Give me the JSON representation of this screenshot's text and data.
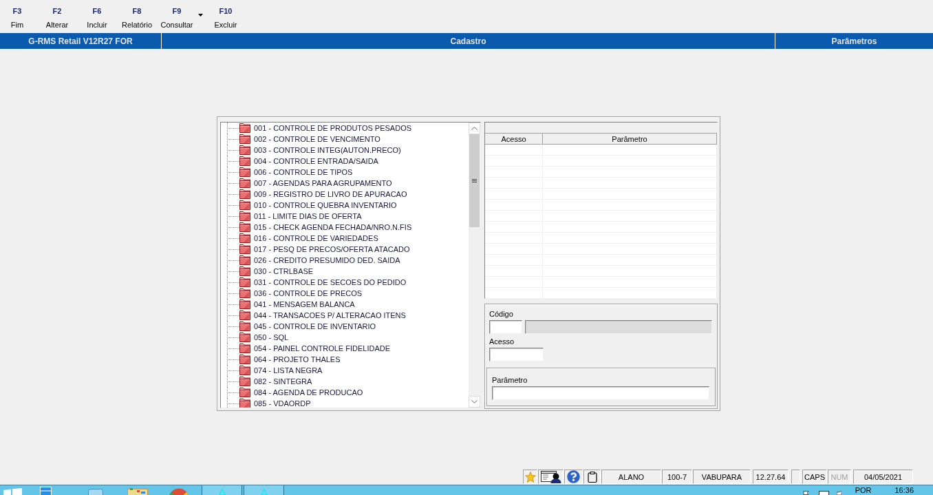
{
  "toolbar": {
    "buttons": [
      {
        "key": "F3",
        "label": "Fim",
        "kind": "plain"
      },
      {
        "key": "F2",
        "label": "Alterar",
        "kind": "plain"
      },
      {
        "key": "F6",
        "label": "Incluir",
        "kind": "plain"
      },
      {
        "key": "F8",
        "label": "Relatório",
        "kind": "plain"
      },
      {
        "key": "F9",
        "label": "Consultar",
        "kind": "dropdown"
      },
      {
        "key": "F10",
        "label": "Excluir",
        "kind": "plain"
      }
    ]
  },
  "title_bar": {
    "sections": [
      {
        "text": "G-RMS Retail V12R27 FOR",
        "kind": "app"
      },
      {
        "text": "Cadastro",
        "kind": "screen"
      },
      {
        "text": "Parâmetros",
        "kind": "module"
      }
    ]
  },
  "tree": {
    "items": [
      {
        "label": "001 - CONTROLE DE PRODUTOS PESADOS",
        "selected": false
      },
      {
        "label": "002 - CONTROLE DE VENCIMENTO",
        "selected": false
      },
      {
        "label": "003 - CONTROLE INTEG(AUTON.PRECO)",
        "selected": false
      },
      {
        "label": "004 - CONTROLE ENTRADA/SAIDA",
        "selected": false
      },
      {
        "label": "006 - CONTROLE DE TIPOS",
        "selected": false
      },
      {
        "label": "007 - AGENDAS PARA AGRUPAMENTO",
        "selected": false
      },
      {
        "label": "009 - REGISTRO DE LIVRO DE APURACAO",
        "selected": false
      },
      {
        "label": "010 - CONTROLE QUEBRA INVENTARIO",
        "selected": false
      },
      {
        "label": "011 - LIMITE DIAS DE OFERTA",
        "selected": false
      },
      {
        "label": "015 - CHECK AGENDA FECHADA/NRO.N.FIS",
        "selected": false
      },
      {
        "label": "016 - CONTROLE DE VARIEDADES",
        "selected": false
      },
      {
        "label": "017 - PESQ DE PRECOS/OFERTA ATACADO",
        "selected": false
      },
      {
        "label": "026 - CREDITO PRESUMIDO DED. SAIDA",
        "selected": false
      },
      {
        "label": "030 - CTRLBASE",
        "selected": false
      },
      {
        "label": "031 - CONTROLE DE SECOES DO PEDIDO",
        "selected": false
      },
      {
        "label": "036 - CONTROLE DE PRECOS",
        "selected": false
      },
      {
        "label": "041 - MENSAGEM BALANCA",
        "selected": false
      },
      {
        "label": "044 - TRANSACOES P/ ALTERACAO ITENS",
        "selected": false
      },
      {
        "label": "045 - CONTROLE DE INVENTARIO",
        "selected": false
      },
      {
        "label": "050 - SQL",
        "selected": false
      },
      {
        "label": "054 - PAINEL CONTROLE FIDELIDADE",
        "selected": false
      },
      {
        "label": "064 - PROJETO THALES",
        "selected": false
      },
      {
        "label": "074 - LISTA NEGRA",
        "selected": false
      },
      {
        "label": "082 - SINTEGRA",
        "selected": false
      },
      {
        "label": "084 - AGENDA DE PRODUCAO",
        "selected": false
      },
      {
        "label": "085 - VDAORDP",
        "selected": false
      }
    ]
  },
  "grid": {
    "columns": [
      "Acesso",
      "Parâmetro"
    ]
  },
  "form": {
    "fields": [
      {
        "label": "Código",
        "kind": "lookup",
        "description": {
          "disabled": true
        }
      },
      {
        "label": "Acesso",
        "kind": "text"
      }
    ],
    "group": {
      "label": "Parâmetro"
    }
  },
  "status_bar": {
    "fields": [
      {
        "kind": "text",
        "text": "ALANO"
      },
      {
        "kind": "text",
        "text": "100-7"
      },
      {
        "kind": "text",
        "text": "VABUPARA"
      },
      {
        "kind": "text",
        "text": "12.27.64"
      },
      {
        "kind": "blank"
      },
      {
        "kind": "indicator",
        "text": "CAPS",
        "on": true
      },
      {
        "kind": "indicator",
        "text": "NUM",
        "on": false
      },
      {
        "kind": "text",
        "text": "04/05/2021"
      }
    ]
  },
  "taskbar": {
    "language": "POR",
    "time": "16:36"
  }
}
